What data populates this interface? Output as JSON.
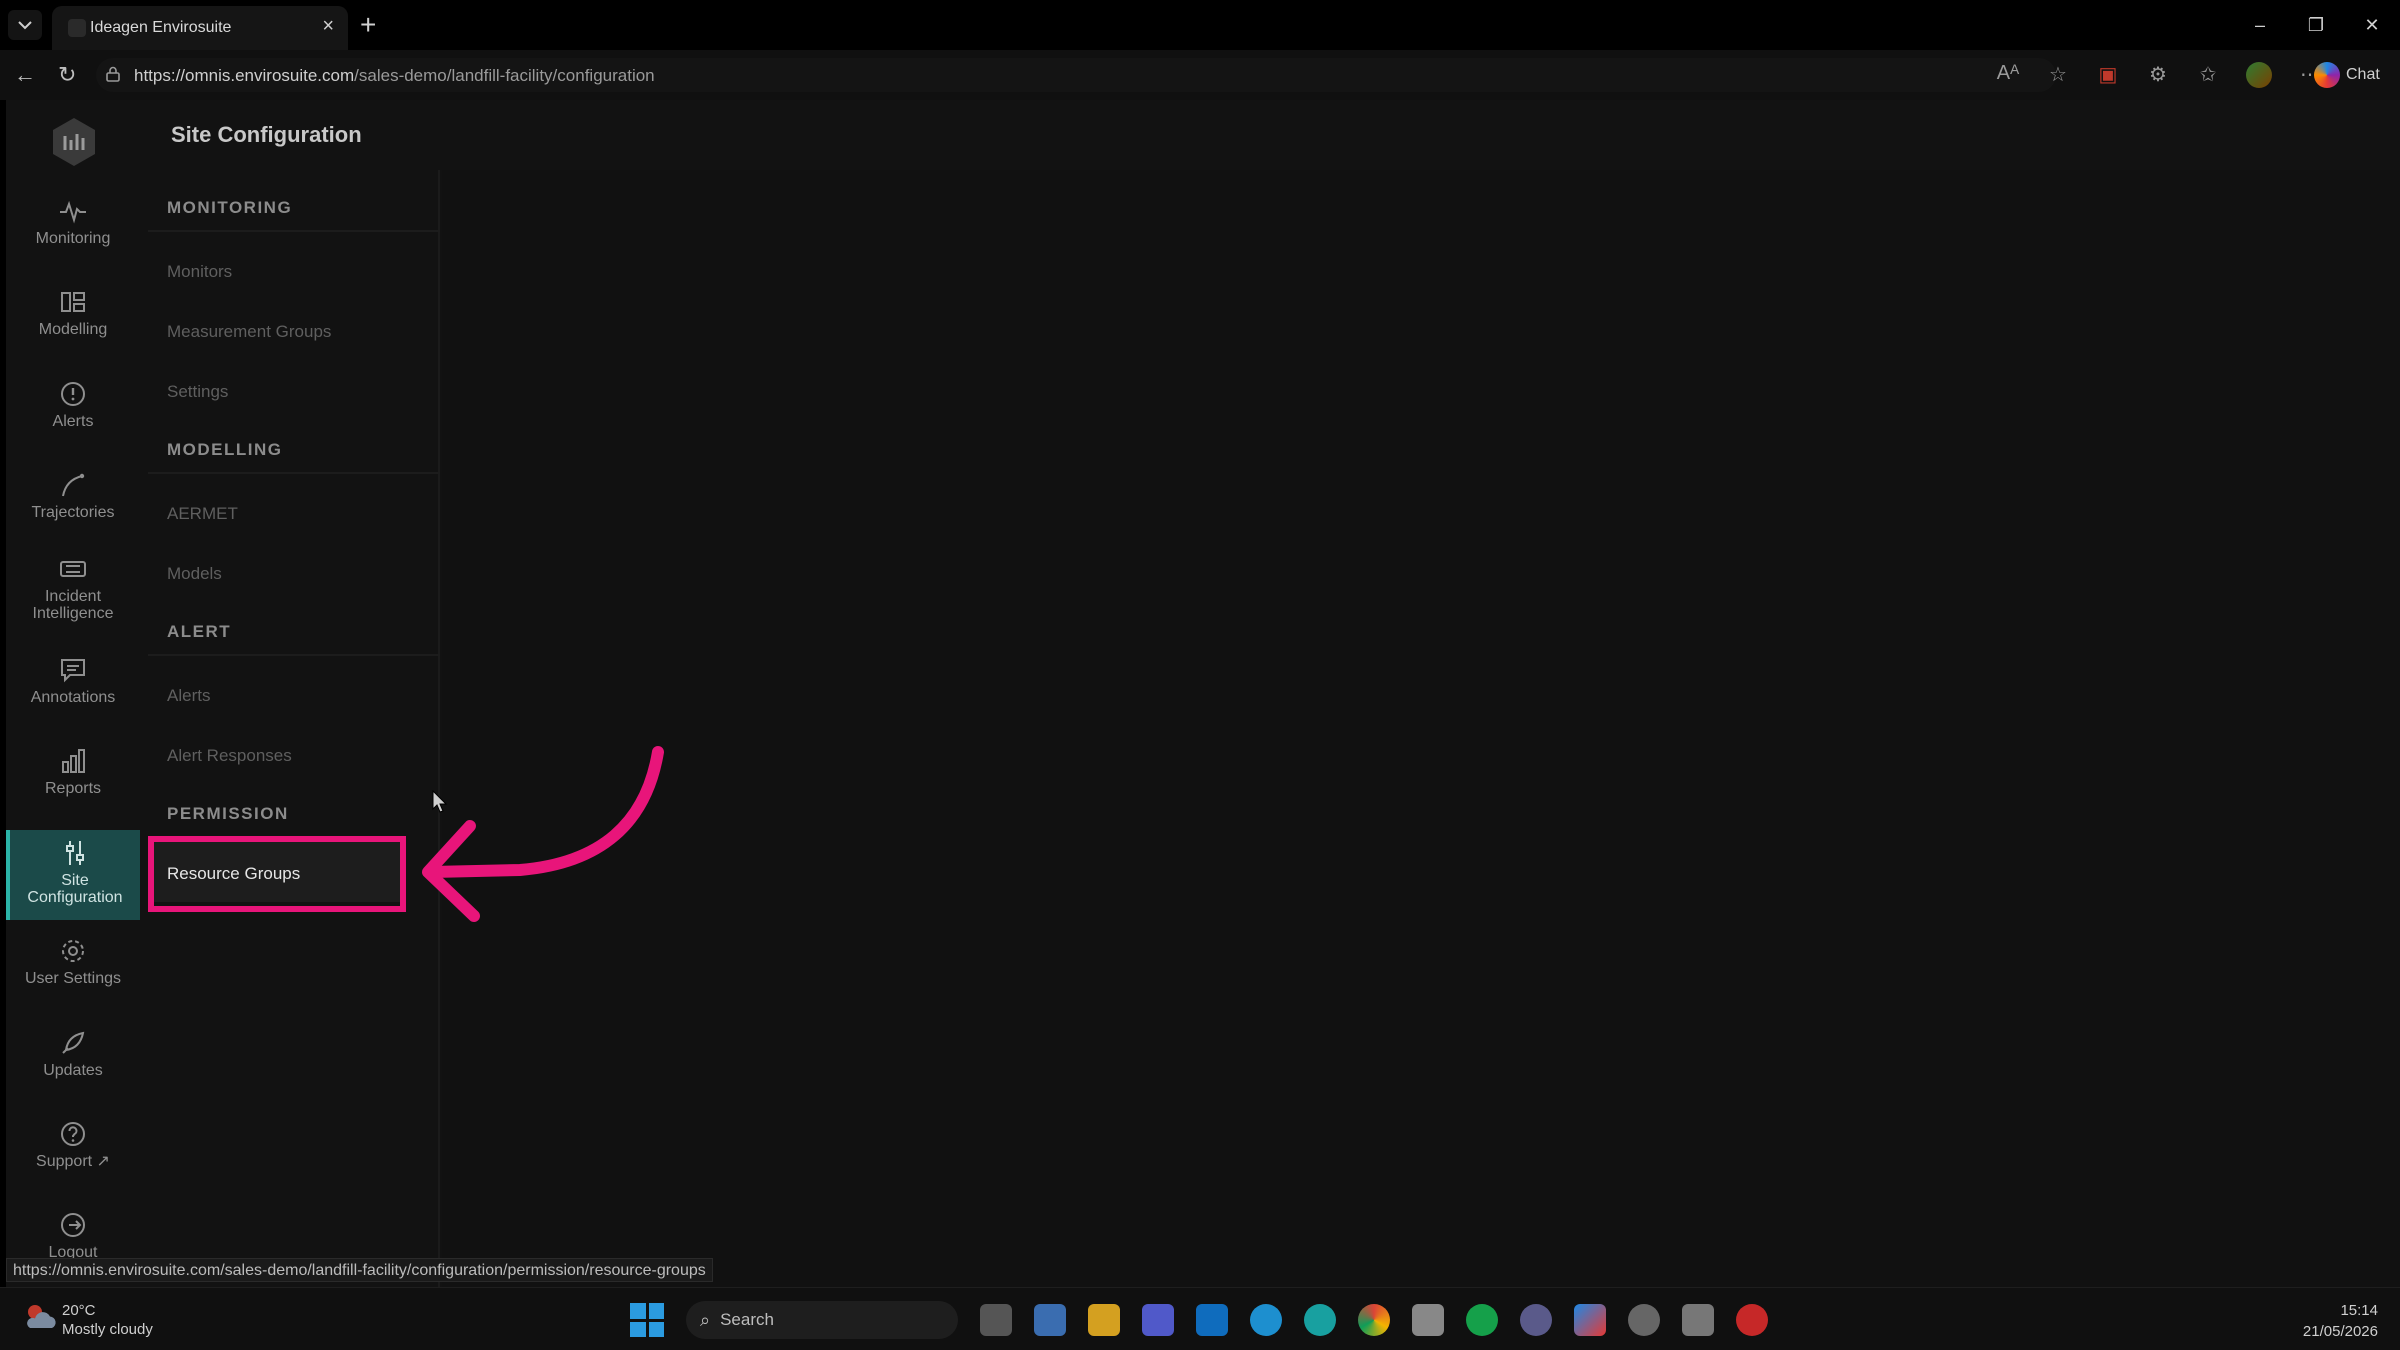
{
  "browser": {
    "tab_title": "Ideagen Envirosuite",
    "url_host": "https://omnis.envirosuite.com",
    "url_path": "/sales-demo/landfill-facility/configuration",
    "chat_label": "Chat",
    "status_url": "https://omnis.envirosuite.com/sales-demo/landfill-facility/configuration/permission/resource-groups"
  },
  "app": {
    "page_title": "Site Configuration",
    "nav": [
      {
        "label": "Monitoring",
        "icon": "pulse-icon"
      },
      {
        "label": "Modelling",
        "icon": "layout-icon"
      },
      {
        "label": "Alerts",
        "icon": "alert-circle-icon"
      },
      {
        "label": "Trajectories",
        "icon": "trajectory-icon"
      },
      {
        "label": "Incident Intelligence",
        "icon": "incident-icon"
      },
      {
        "label": "Annotations",
        "icon": "comment-icon"
      },
      {
        "label": "Reports",
        "icon": "bar-chart-icon"
      },
      {
        "label": "Site Configuration",
        "icon": "sliders-icon",
        "active": true
      },
      {
        "label": "User Settings",
        "icon": "gear-icon"
      },
      {
        "label": "Updates",
        "icon": "rocket-icon"
      },
      {
        "label": "Support",
        "icon": "help-circle-icon"
      },
      {
        "label": "Logout",
        "icon": "logout-icon"
      }
    ],
    "sections": [
      {
        "title": "MONITORING",
        "items": [
          "Monitors",
          "Measurement Groups",
          "Settings"
        ]
      },
      {
        "title": "MODELLING",
        "items": [
          "AERMET",
          "Models"
        ]
      },
      {
        "title": "ALERT",
        "items": [
          "Alerts",
          "Alert Responses"
        ]
      },
      {
        "title": "PERMISSION",
        "items": [
          "Resource Groups"
        ]
      }
    ]
  },
  "taskbar": {
    "weather_temp": "20°C",
    "weather_desc": "Mostly cloudy",
    "search_label": "Search",
    "time": "15:14",
    "date": "21/05/2026"
  },
  "colors": {
    "accent": "#2bb4a8",
    "highlight": "#e8157a"
  }
}
